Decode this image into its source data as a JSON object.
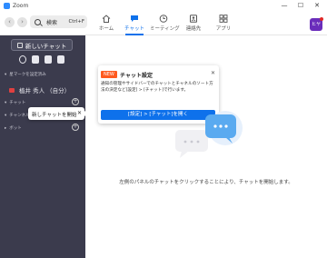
{
  "window": {
    "title": "Zoom",
    "controls": [
      "—",
      "☐",
      "✕"
    ]
  },
  "toolbar": {
    "back": "‹",
    "forward": "›",
    "search": {
      "text": "検索",
      "shortcut": "Ctrl+F"
    },
    "tabs": [
      {
        "label": "ホーム",
        "icon": "home-icon",
        "active": false
      },
      {
        "label": "チャット",
        "icon": "chat-icon",
        "active": true
      },
      {
        "label": "ミーティング",
        "icon": "clock-icon",
        "active": false
      },
      {
        "label": "連絡先",
        "icon": "contacts-icon",
        "active": false
      },
      {
        "label": "アプリ",
        "icon": "apps-icon",
        "active": false
      }
    ],
    "avatar": "ヒヤ"
  },
  "sidebar": {
    "new_chat": "新しいチャット",
    "quick_icons": [
      "at-icon",
      "file-icon",
      "star-file-icon",
      "image-icon"
    ],
    "sections": [
      {
        "label": "星マークを設定済み"
      },
      {
        "label": "チャット"
      },
      {
        "label": "チャンネル"
      },
      {
        "label": "ボット"
      }
    ],
    "contact_name": "植井 秀人 （自分）",
    "tooltip": {
      "text": "新しチャットを開始",
      "close": "✕"
    }
  },
  "popup": {
    "badge": "NEW",
    "title": "チャット設定",
    "close": "✕",
    "body": "通知の管理やサイドバーでのチャットとチャネルのソート方法の決定など[設定] > [チャット]で行います。",
    "button": "[設定] > [チャット]を開く"
  },
  "main": {
    "helper": "左側のパネルのチャットをクリックすることにより、チャットを開始します。"
  },
  "colors": {
    "accent": "#0e71eb",
    "sidebar": "#3b3b4d",
    "badge": "#ff5a1f",
    "bubble": "#5aaaf0"
  }
}
